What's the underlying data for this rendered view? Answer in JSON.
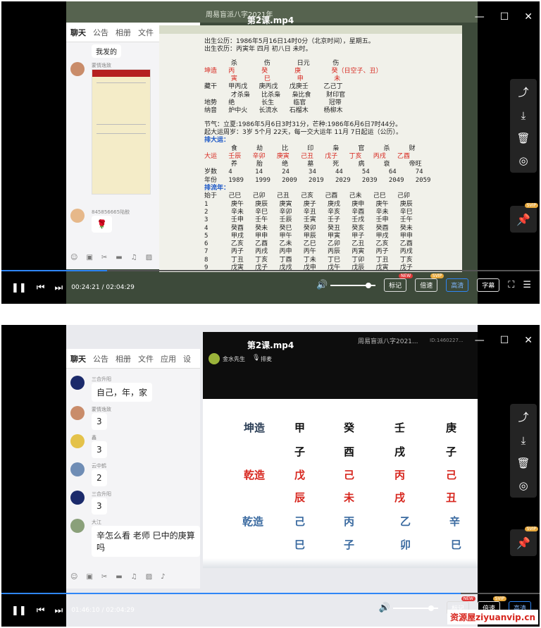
{
  "player1": {
    "title": "第2课.mp4",
    "window_caption": "周易盲派八字2021年",
    "time_current": "00:24:21",
    "time_total": "02:04:29",
    "progress": 0.196,
    "chat": {
      "tabs": [
        "聊天",
        "公告",
        "相册",
        "文件"
      ],
      "messages": [
        {
          "nick": "",
          "text": "我发的"
        },
        {
          "nick": "蒙情逸致",
          "text": ""
        },
        {
          "nick": "845856665陆鲛",
          "text": "🌹"
        }
      ]
    },
    "doc_lines": [
      "出生公历：1986年5月16日14时0分（北京时间），星期五。",
      "出生农历：丙寅年 四月 初八日 未时。"
    ],
    "doc_pre": [
      "       杀       伤       日元      伤",
      "坤造   丙       癸       庚        癸（日空子、丑）",
      "       寅       巳       申        未",
      "藏干   甲丙戊   庚丙戊   戊庚壬    乙己丁",
      "       才杀枭   比杀枭   枭比食    财印官",
      "地势   绝       长生     临官      冠带",
      "纳音   炉中火   长流水   石榴木    杨柳木"
    ],
    "doc_luck": [
      "节气：立夏:1986年5月6日3时31分，芒种:1986年6月6日7时44分。",
      "起大运周岁：3岁 5个月 22天，每一交大运年 11月 7日起运（公历）。"
    ],
    "doc_dayun_title": "排大运：",
    "doc_dayun_pre": [
      "       食     劫     比     印     枭     官     杀     财",
      "大运   壬辰   辛卯   庚寅   己丑   戊子   丁亥   丙戌   乙酉",
      "       养     胎     绝     墓     死     病     衰     帝旺",
      "岁数   4      14     24     34     44     54     64     74",
      "年份   1989   1999   2009   2019   2029   2039   2049   2059"
    ],
    "doc_liunian_title": "排流年：",
    "doc_liunian_pre": [
      "始于   己巳   己卯   己丑   己亥   己酉   己未   己巳   己卯",
      "1      庚午   庚辰   庚寅   庚子   庚戌   庚申   庚午   庚辰",
      "2      辛未   辛巳   辛卯   辛丑   辛亥   辛酉   辛未   辛巳",
      "3      壬申   壬午   壬辰   壬寅   壬子   壬戌   壬申   壬午",
      "4      癸酉   癸未   癸巳   癸卯   癸丑   癸亥   癸酉   癸未",
      "5      甲戌   甲申   甲午   甲辰   甲寅   甲子   甲戌   甲申",
      "6      乙亥   乙酉   乙未   乙巳   乙卯   乙丑   乙亥   乙酉",
      "7      丙子   丙戌   丙申   丙午   丙辰   丙寅   丙子   丙戌",
      "8      丁丑   丁亥   丁酉   丁未   丁巳   丁卯   丁丑   丁亥",
      "9      戊寅   戊子   戊戌   戊申   戊午   戊辰   戊寅   戊子"
    ]
  },
  "player2": {
    "title": "第2课.mp4",
    "window_caption": "周易盲派八字2021...",
    "session_id": "ID:1460227...",
    "teacher": "金水先生",
    "mic_label": "排麦",
    "time_current": "01:46:10",
    "time_total": "02:04:29",
    "progress": 0.853,
    "chat": {
      "tabs": [
        "聊天",
        "公告",
        "相册",
        "文件",
        "应用",
        "设"
      ],
      "messages": [
        {
          "nick": "三合升阳",
          "text": "自己，年，家"
        },
        {
          "nick": "蒙情逸致",
          "text": "3"
        },
        {
          "nick": "鑫",
          "text": "3"
        },
        {
          "nick": "云中鹤",
          "text": "2"
        },
        {
          "nick": "三合升阳",
          "text": "3"
        },
        {
          "nick": "大江",
          "text": "辛怎么看 老师 巳中的庚算吗"
        }
      ]
    },
    "bazi": {
      "kun_label": "坤造",
      "kun_stems": [
        "甲",
        "癸",
        "壬",
        "庚"
      ],
      "kun_branches": [
        "子",
        "酉",
        "戌",
        "子"
      ],
      "qian1_label": "乾造",
      "qian1_stems": [
        "戊",
        "己",
        "丙",
        "己"
      ],
      "qian1_branches": [
        "辰",
        "未",
        "戌",
        "丑"
      ],
      "qian2_label": "乾造",
      "qian2_stems": [
        "己",
        "丙",
        "乙",
        "辛"
      ],
      "qian2_branches": [
        "巳",
        "子",
        "卯",
        "巳"
      ]
    }
  },
  "controls": {
    "caption_label": "标记",
    "caption_badge": "NEW",
    "speed_label": "倍速",
    "speed_badge": "SVIP",
    "quality_label": "高清",
    "subtitle_label": "字幕",
    "pin_badge": "SVIP"
  },
  "watermark": "资源屋ziyuanvip.cn"
}
